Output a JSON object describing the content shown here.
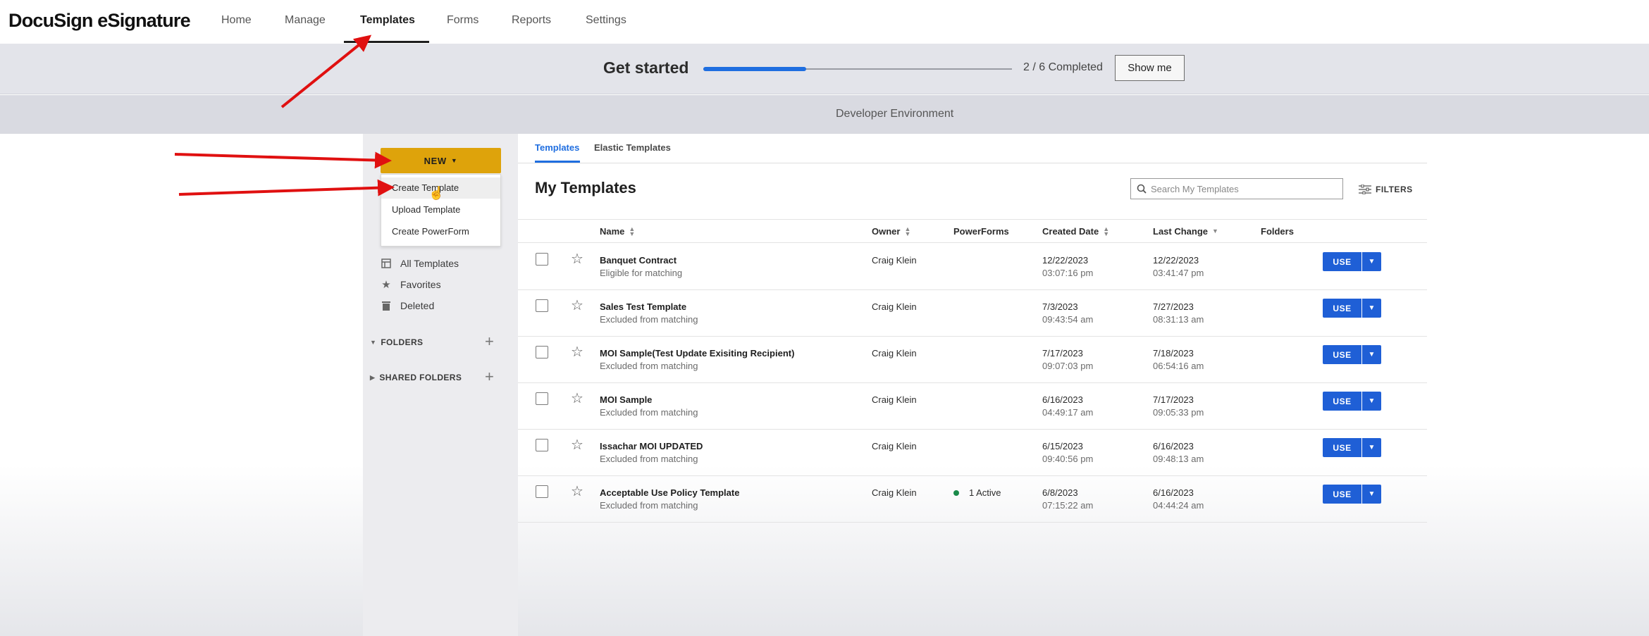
{
  "app": {
    "brand": "DocuSign eSignature"
  },
  "nav": {
    "items": [
      {
        "label": "Home"
      },
      {
        "label": "Manage"
      },
      {
        "label": "Templates"
      },
      {
        "label": "Forms"
      },
      {
        "label": "Reports"
      },
      {
        "label": "Settings"
      }
    ],
    "active": "Templates"
  },
  "getstarted": {
    "title": "Get started",
    "progress": "2 / 6 Completed",
    "progress_fraction": 0.333,
    "button": "Show me"
  },
  "env_banner": "Developer Environment",
  "sidebar": {
    "new_button": "NEW",
    "new_menu": [
      "Create Template",
      "Upload Template",
      "Create PowerForm"
    ],
    "items": [
      {
        "label": "All Templates",
        "icon": "template-icon"
      },
      {
        "label": "Favorites",
        "icon": "star-filled-icon"
      },
      {
        "label": "Deleted",
        "icon": "trash-icon"
      }
    ],
    "sections": [
      {
        "label": "FOLDERS"
      },
      {
        "label": "SHARED FOLDERS"
      }
    ]
  },
  "tabs": [
    {
      "label": "Templates"
    },
    {
      "label": "Elastic Templates"
    }
  ],
  "main": {
    "title": "My Templates",
    "search_placeholder": "Search My Templates",
    "filters_label": "FILTERS"
  },
  "table": {
    "columns": {
      "name": "Name",
      "owner": "Owner",
      "powerforms": "PowerForms",
      "created": "Created Date",
      "last_change": "Last Change",
      "folders": "Folders"
    },
    "use_label": "USE",
    "rows": [
      {
        "name": "Banquet Contract",
        "status": "Eligible for matching",
        "owner": "Craig Klein",
        "powerforms": "",
        "created_date": "12/22/2023",
        "created_time": "03:07:16 pm",
        "changed_date": "12/22/2023",
        "changed_time": "03:41:47 pm"
      },
      {
        "name": "Sales Test Template",
        "status": "Excluded from matching",
        "owner": "Craig Klein",
        "powerforms": "",
        "created_date": "7/3/2023",
        "created_time": "09:43:54 am",
        "changed_date": "7/27/2023",
        "changed_time": "08:31:13 am"
      },
      {
        "name": "MOI Sample(Test Update Exisiting Recipient)",
        "status": "Excluded from matching",
        "owner": "Craig Klein",
        "powerforms": "",
        "created_date": "7/17/2023",
        "created_time": "09:07:03 pm",
        "changed_date": "7/18/2023",
        "changed_time": "06:54:16 am"
      },
      {
        "name": "MOI Sample",
        "status": "Excluded from matching",
        "owner": "Craig Klein",
        "powerforms": "",
        "created_date": "6/16/2023",
        "created_time": "04:49:17 am",
        "changed_date": "7/17/2023",
        "changed_time": "09:05:33 pm"
      },
      {
        "name": "Issachar MOI UPDATED",
        "status": "Excluded from matching",
        "owner": "Craig Klein",
        "powerforms": "",
        "created_date": "6/15/2023",
        "created_time": "09:40:56 pm",
        "changed_date": "6/16/2023",
        "changed_time": "09:48:13 am"
      },
      {
        "name": "Acceptable Use Policy Template",
        "status": "Excluded from matching",
        "owner": "Craig Klein",
        "powerforms": "1 Active",
        "created_date": "6/8/2023",
        "created_time": "07:15:22 am",
        "changed_date": "6/16/2023",
        "changed_time": "04:44:24 am"
      }
    ]
  },
  "colors": {
    "accent": "#1f6ee0",
    "new_button": "#dea30b",
    "use_button": "#1f5fd6",
    "annotation_arrow": "#e01010"
  }
}
